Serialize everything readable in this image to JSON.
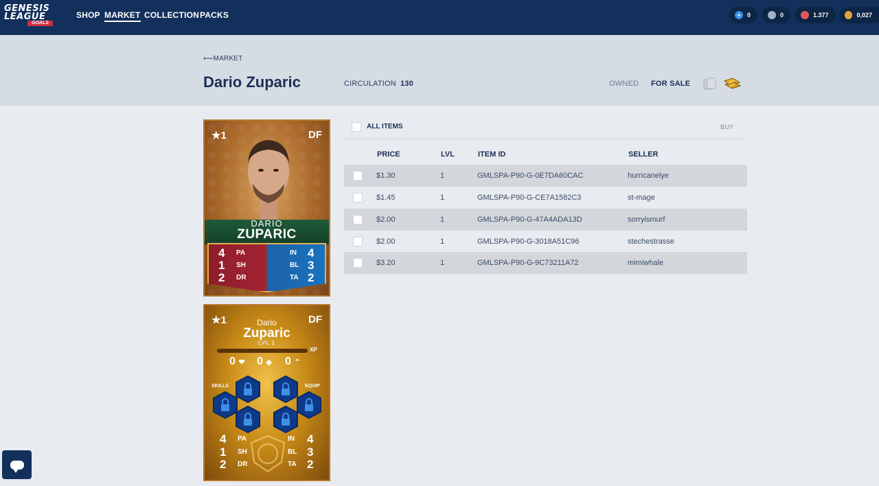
{
  "nav": {
    "logo": {
      "line1": "GENESIS",
      "line2": "LEAGUE",
      "line3": "GOALS"
    },
    "links": [
      "SHOP",
      "MARKET",
      "COLLECTION",
      "PACKS"
    ],
    "active": "MARKET",
    "currencies": [
      {
        "icon": "plus-token-icon",
        "value": "0",
        "color": "#3c8ce6"
      },
      {
        "icon": "silver-token-icon",
        "value": "0",
        "color": "#9fb2c8"
      },
      {
        "icon": "red-token-icon",
        "value": "1.377",
        "color": "#e05a5a"
      },
      {
        "icon": "gold-coin-icon",
        "value": "0,027",
        "color": "#e3a23a"
      }
    ]
  },
  "header": {
    "back": "⟵MARKET",
    "title": "Dario Zuparic",
    "circulation_label": "CIRCULATION",
    "circulation_value": "130",
    "tab_owned": "OWNED",
    "tab_for_sale": "FOR SALE"
  },
  "card_front": {
    "star": "★1",
    "position": "DF",
    "first_name": "DARIO",
    "last_name": "ZUPARIC",
    "left_stats": [
      {
        "value": "4",
        "label": "PA"
      },
      {
        "value": "1",
        "label": "SH"
      },
      {
        "value": "2",
        "label": "DR"
      }
    ],
    "right_stats": [
      {
        "label": "IN",
        "value": "4"
      },
      {
        "label": "BL",
        "value": "3"
      },
      {
        "label": "TA",
        "value": "2"
      }
    ]
  },
  "card_back": {
    "star": "★1",
    "position": "DF",
    "first_name": "Dario",
    "last_name": "Zuparic",
    "level": "LVL 1",
    "xp_label": "XP",
    "counters": [
      "0",
      "0",
      "0"
    ],
    "skills_label": "SKILLS",
    "equip_label": "EQUIP",
    "left_stats": [
      {
        "value": "4",
        "label": "PA"
      },
      {
        "value": "1",
        "label": "SH"
      },
      {
        "value": "2",
        "label": "DR"
      }
    ],
    "right_stats": [
      {
        "label": "IN",
        "value": "4"
      },
      {
        "label": "BL",
        "value": "3"
      },
      {
        "label": "TA",
        "value": "2"
      }
    ]
  },
  "listing": {
    "all_items": "ALL ITEMS",
    "buy": "BUY",
    "columns": [
      "PRICE",
      "LVL",
      "ITEM ID",
      "SELLER"
    ],
    "rows": [
      {
        "price": "$1.30",
        "lvl": "1",
        "item_id": "GMLSPA-P90-G-0E7DA60CAC",
        "seller": "hurricanelye"
      },
      {
        "price": "$1.45",
        "lvl": "1",
        "item_id": "GMLSPA-P90-G-CE7A1582C3",
        "seller": "st-mage"
      },
      {
        "price": "$2.00",
        "lvl": "1",
        "item_id": "GMLSPA-P90-G-47A4ADA13D",
        "seller": "sorryismurf"
      },
      {
        "price": "$2.00",
        "lvl": "1",
        "item_id": "GMLSPA-P90-G-3018A51C96",
        "seller": "stechestrasse"
      },
      {
        "price": "$3.20",
        "lvl": "1",
        "item_id": "GMLSPA-P90-G-9C73211A72",
        "seller": "mimiwhale"
      }
    ]
  }
}
